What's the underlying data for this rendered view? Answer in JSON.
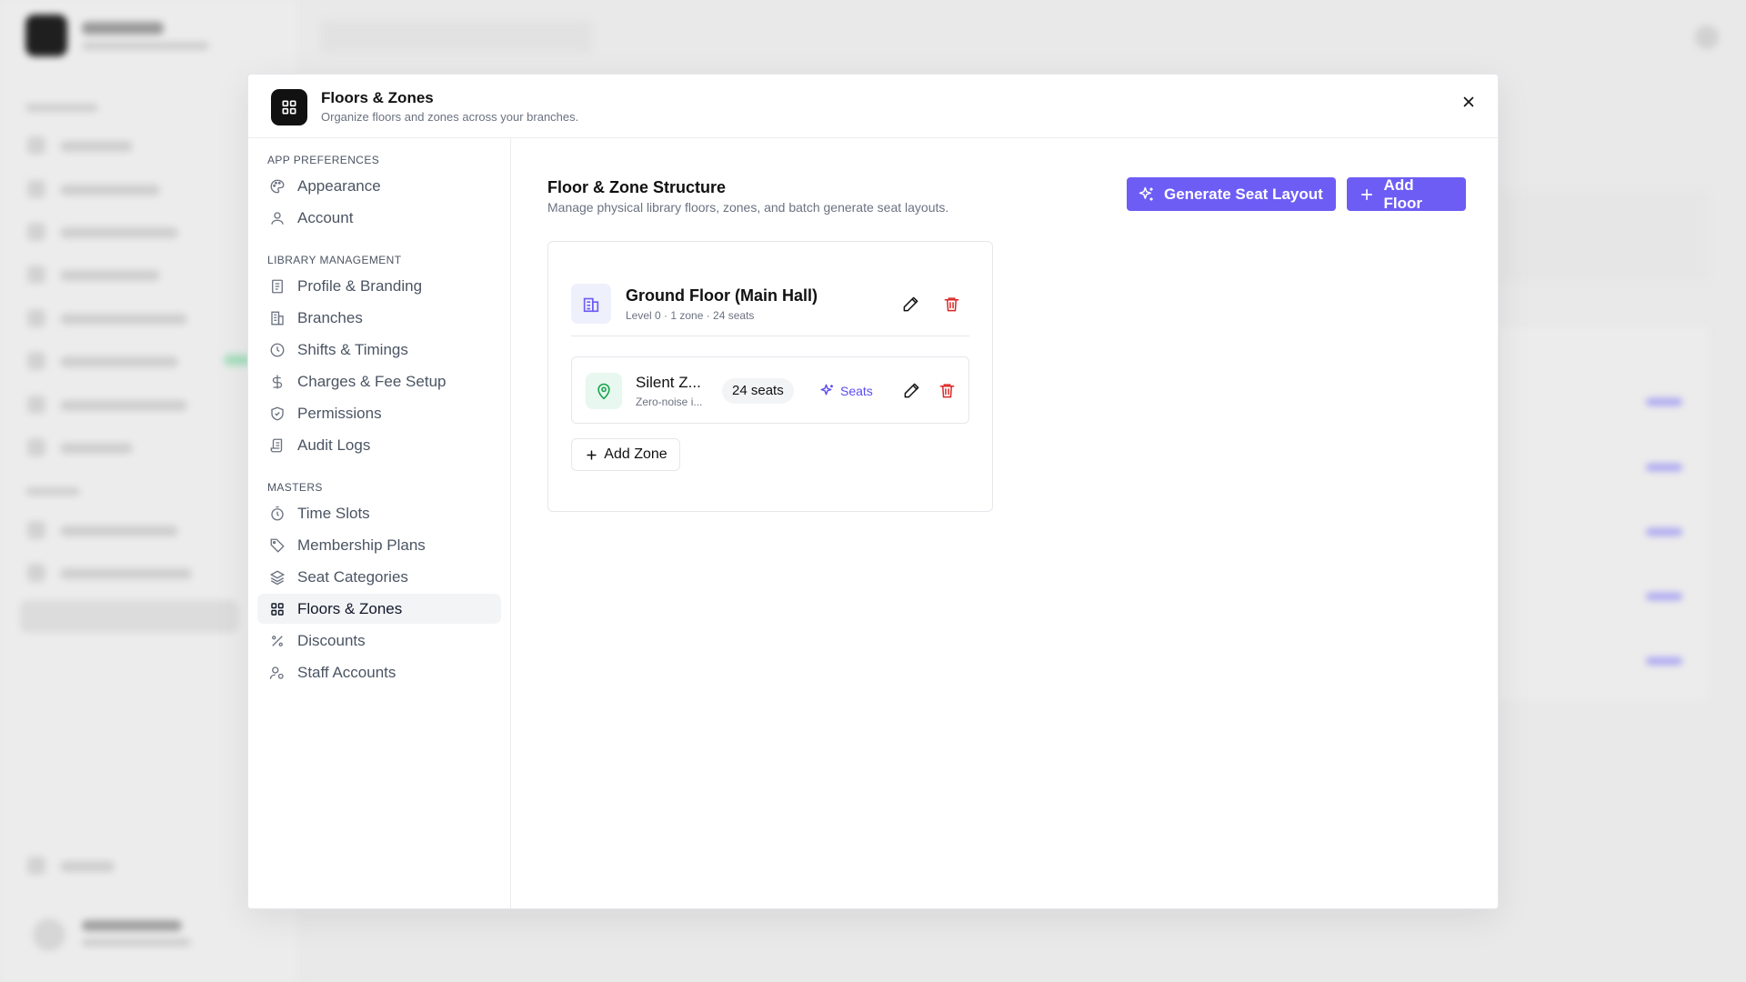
{
  "modal": {
    "title": "Floors & Zones",
    "subtitle": "Organize floors and zones across your branches."
  },
  "nav": {
    "sections": [
      {
        "label": "APP PREFERENCES"
      },
      {
        "label": "LIBRARY MANAGEMENT"
      },
      {
        "label": "MASTERS"
      }
    ],
    "items": [
      {
        "label": "Appearance",
        "icon": "palette-icon"
      },
      {
        "label": "Account",
        "icon": "user-icon"
      },
      {
        "label": "Profile & Branding",
        "icon": "receipt-icon"
      },
      {
        "label": "Branches",
        "icon": "building-icon"
      },
      {
        "label": "Shifts & Timings",
        "icon": "clock-icon"
      },
      {
        "label": "Charges & Fee Setup",
        "icon": "dollar-icon"
      },
      {
        "label": "Permissions",
        "icon": "shield-icon"
      },
      {
        "label": "Audit Logs",
        "icon": "scroll-icon"
      },
      {
        "label": "Time Slots",
        "icon": "timer-icon"
      },
      {
        "label": "Membership Plans",
        "icon": "tag-icon"
      },
      {
        "label": "Seat Categories",
        "icon": "layers-icon"
      },
      {
        "label": "Floors & Zones",
        "icon": "grid-icon",
        "active": true
      },
      {
        "label": "Discounts",
        "icon": "percent-icon"
      },
      {
        "label": "Staff Accounts",
        "icon": "user-cog-icon"
      }
    ]
  },
  "content": {
    "title": "Floor & Zone Structure",
    "subtitle": "Manage physical library floors, zones, and batch generate seat layouts.",
    "generate_label": "Generate Seat Layout",
    "add_floor_label": "Add Floor",
    "floor": {
      "name": "Ground Floor (Main Hall)",
      "meta": "Level 0 · 1 zone · 24 seats"
    },
    "zone": {
      "name": "Silent Z...",
      "desc": "Zero-noise i...",
      "badge": "24 seats",
      "seats_label": "Seats"
    },
    "add_zone_label": "Add Zone"
  },
  "colors": {
    "accent": "#6d5df5",
    "danger": "#dc2626",
    "zone_green": "#16a34a"
  }
}
